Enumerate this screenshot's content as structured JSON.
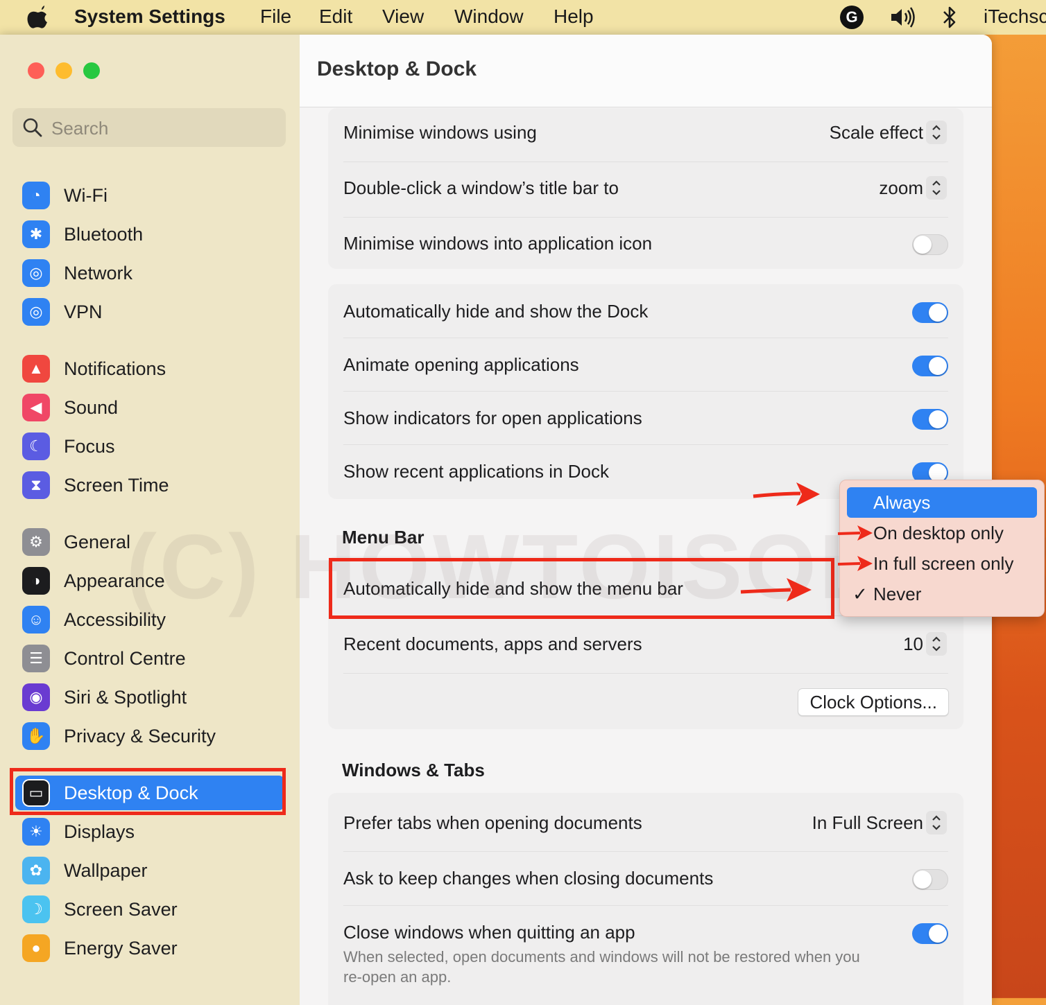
{
  "menubar": {
    "app_name": "System Settings",
    "items": [
      "File",
      "Edit",
      "View",
      "Window",
      "Help"
    ],
    "g_label": "G",
    "user": "iTechsc"
  },
  "sidebar": {
    "search_placeholder": "Search",
    "items": [
      {
        "label": "Wi-Fi",
        "icon": "wifi-icon",
        "color": "#2f82f2"
      },
      {
        "label": "Bluetooth",
        "icon": "bluetooth-icon",
        "color": "#2f82f2"
      },
      {
        "label": "Network",
        "icon": "globe-icon",
        "color": "#2f82f2"
      },
      {
        "label": "VPN",
        "icon": "vpn-globe-icon",
        "color": "#2f82f2"
      },
      {
        "label": "Notifications",
        "icon": "bell-icon",
        "color": "#f0473f"
      },
      {
        "label": "Sound",
        "icon": "speaker-icon",
        "color": "#f04766"
      },
      {
        "label": "Focus",
        "icon": "moon-icon",
        "color": "#5b5ce2"
      },
      {
        "label": "Screen Time",
        "icon": "hourglass-icon",
        "color": "#5b5ce2"
      },
      {
        "label": "General",
        "icon": "gear-icon",
        "color": "#8e8e93"
      },
      {
        "label": "Appearance",
        "icon": "appearance-icon",
        "color": "#1c1c1e"
      },
      {
        "label": "Accessibility",
        "icon": "accessibility-icon",
        "color": "#2f82f2"
      },
      {
        "label": "Control Centre",
        "icon": "control-centre-icon",
        "color": "#8e8e93"
      },
      {
        "label": "Siri & Spotlight",
        "icon": "siri-icon",
        "color": "#6a3bd1"
      },
      {
        "label": "Privacy & Security",
        "icon": "hand-icon",
        "color": "#2f82f2"
      },
      {
        "label": "Desktop & Dock",
        "icon": "dock-icon",
        "color": "#1c1c1e"
      },
      {
        "label": "Displays",
        "icon": "sun-icon",
        "color": "#2f82f2"
      },
      {
        "label": "Wallpaper",
        "icon": "flower-icon",
        "color": "#4bb4f0"
      },
      {
        "label": "Screen Saver",
        "icon": "screensaver-icon",
        "color": "#4bc3f0"
      },
      {
        "label": "Energy Saver",
        "icon": "bulb-icon",
        "color": "#f5a623"
      }
    ],
    "selected": "Desktop & Dock"
  },
  "content": {
    "title": "Desktop & Dock",
    "group1": {
      "minimise_label": "Minimise windows using",
      "minimise_value": "Scale effect",
      "doubleclick_label": "Double-click a window’s title bar to",
      "doubleclick_value": "zoom",
      "minimise_icon_label": "Minimise windows into application icon",
      "minimise_icon_on": false
    },
    "group2": {
      "autohide_dock_label": "Automatically hide and show the Dock",
      "animate_label": "Animate opening applications",
      "indicators_label": "Show indicators for open applications",
      "recent_label": "Show recent applications in Dock"
    },
    "menubar_section": {
      "title": "Menu Bar",
      "autohide_label": "Automatically hide and show the menu bar",
      "recent_docs_label": "Recent documents, apps and servers",
      "recent_docs_value": "10",
      "clock_button": "Clock Options..."
    },
    "windows_section": {
      "title": "Windows & Tabs",
      "prefer_tabs_label": "Prefer tabs when opening documents",
      "prefer_tabs_value": "In Full Screen",
      "ask_keep_label": "Ask to keep changes when closing documents",
      "close_windows_label": "Close windows when quitting an app",
      "close_windows_desc_1": "When selected, open documents and windows will not be restored when you",
      "close_windows_desc_2": "re-open an app."
    }
  },
  "popup": {
    "options": [
      "Always",
      "On desktop only",
      "In full screen only",
      "Never"
    ],
    "highlighted": "Always",
    "checked": "Never",
    "check_glyph": "✓"
  },
  "watermark": "(C) HOWTOISOLVE.COM",
  "colors": {
    "accent": "#2f82f2",
    "annotation": "#ee2a1a"
  }
}
